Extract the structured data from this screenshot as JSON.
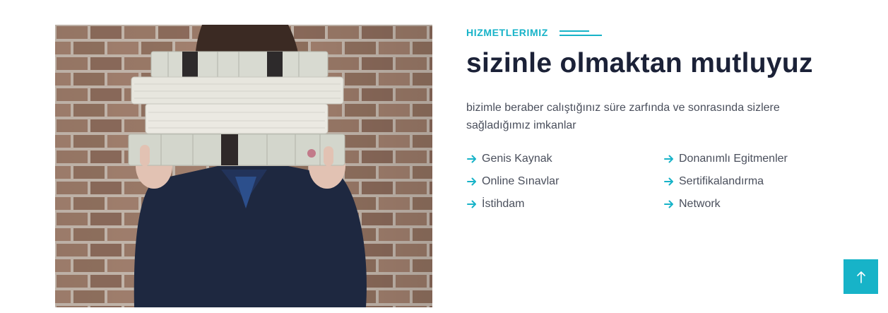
{
  "image": {
    "alt_icon": "person-holding-books-photo",
    "colors": {
      "brick": "#9a7a68",
      "mortar": "#c9bdb3",
      "jacket": "#1f2a44",
      "book": "#d9dbd2"
    }
  },
  "section": {
    "eyebrow": "HIZMETLERIMIZ",
    "title": "sizinle olmaktan mutluyuz",
    "description": "bizimle beraber calıştığınız süre zarfında ve sonrasında sizlere sağladığımız imkanlar",
    "features": [
      {
        "label": "Genis Kaynak",
        "icon": "arrow-right-icon"
      },
      {
        "label": "Donanımlı Egitmenler",
        "icon": "arrow-right-icon"
      },
      {
        "label": "Online Sınavlar",
        "icon": "arrow-right-icon"
      },
      {
        "label": "Sertifikalandırma",
        "icon": "arrow-right-icon"
      },
      {
        "label": "İstihdam",
        "icon": "arrow-right-icon"
      },
      {
        "label": "Network",
        "icon": "arrow-right-icon"
      }
    ]
  },
  "scroll_top": {
    "icon": "arrow-up-icon"
  },
  "colors": {
    "accent": "#17b3c8",
    "heading": "#1b2137",
    "body_text": "#4a4f5c"
  }
}
